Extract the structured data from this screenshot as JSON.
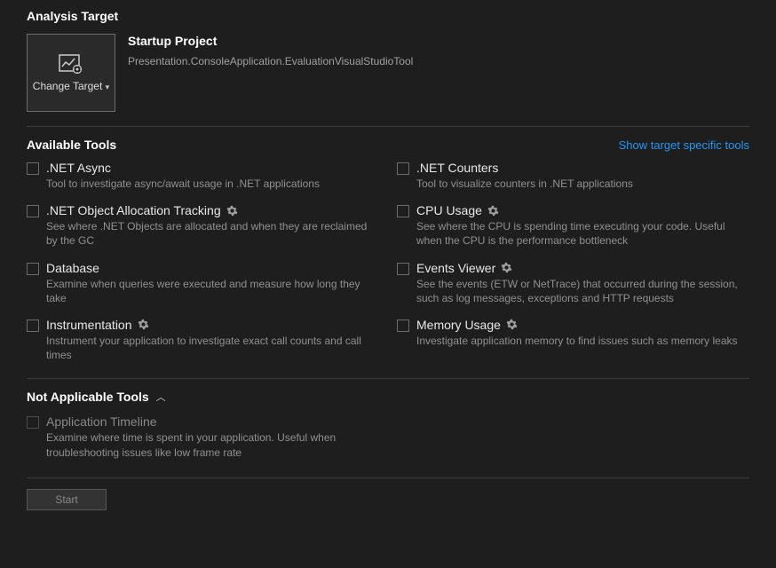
{
  "analysisTarget": {
    "heading": "Analysis Target",
    "changeTargetLabel": "Change Target",
    "startupTitle": "Startup Project",
    "startupProject": "Presentation.ConsoleApplication.EvaluationVisualStudioTool"
  },
  "availableTools": {
    "heading": "Available Tools",
    "link": "Show target specific tools",
    "items": [
      {
        "title": ".NET Async",
        "desc": "Tool to investigate async/await usage in .NET applications",
        "gear": false
      },
      {
        "title": ".NET Counters",
        "desc": "Tool to visualize counters in .NET applications",
        "gear": false
      },
      {
        "title": ".NET Object Allocation Tracking",
        "desc": "See where .NET Objects are allocated and when they are reclaimed by the GC",
        "gear": true
      },
      {
        "title": "CPU Usage",
        "desc": "See where the CPU is spending time executing your code. Useful when the CPU is the performance bottleneck",
        "gear": true
      },
      {
        "title": "Database",
        "desc": "Examine when queries were executed and measure how long they take",
        "gear": false
      },
      {
        "title": "Events Viewer",
        "desc": "See the events (ETW or NetTrace) that occurred during the session, such as log messages, exceptions and HTTP requests",
        "gear": true
      },
      {
        "title": "Instrumentation",
        "desc": "Instrument your application to investigate exact call counts and call times",
        "gear": true
      },
      {
        "title": "Memory Usage",
        "desc": "Investigate application memory to find issues such as memory leaks",
        "gear": true
      }
    ]
  },
  "notApplicable": {
    "heading": "Not Applicable Tools",
    "items": [
      {
        "title": "Application Timeline",
        "desc": "Examine where time is spent in your application. Useful when troubleshooting issues like low frame rate"
      }
    ]
  },
  "startButton": "Start"
}
